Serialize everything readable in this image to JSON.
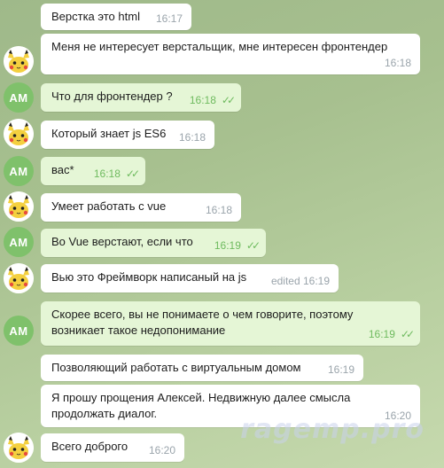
{
  "messages": [
    {
      "from": "other",
      "text": "Верстка это html",
      "time": "16:17"
    },
    {
      "from": "other",
      "text": "Меня не интересует верстальщик, мне интересен фронтендер",
      "time": "16:18"
    },
    {
      "from": "me",
      "text": "Что для фронтендер ?",
      "time": "16:18",
      "read": true
    },
    {
      "from": "other",
      "text": "Который знает js ES6",
      "time": "16:18"
    },
    {
      "from": "me",
      "text": "вас*",
      "time": "16:18",
      "read": true
    },
    {
      "from": "other",
      "text": "Умеет работать с vue",
      "time": "16:18"
    },
    {
      "from": "me",
      "text": "Во Vue верстают, если что",
      "time": "16:19",
      "read": true
    },
    {
      "from": "other",
      "text": "Вью это Фреймворк написаный на js",
      "time": "edited 16:19"
    },
    {
      "from": "me",
      "text": "Скорее всего, вы не понимаете о чем говорите, поэтому\nвозникает такое недопонимание",
      "time": "16:19",
      "read": true
    },
    {
      "from": "other",
      "text": "Позволяющий работать с виртуальным домом",
      "time": "16:19"
    },
    {
      "from": "other",
      "text": "Я прошу прощения Алексей. Недвижную далее смысла\nпродолжать диалог.",
      "time": "16:20"
    },
    {
      "from": "other",
      "text": "Всего доброго",
      "time": "16:20"
    }
  ],
  "me_initials": "AM",
  "read_mark": "✓✓",
  "watermark": "ragemp.pro",
  "colors": {
    "in_bubble": "#ffffff",
    "out_bubble": "#e5f6d6",
    "avatar_am": "#7fc16b",
    "tick": "#6fbb5f"
  }
}
